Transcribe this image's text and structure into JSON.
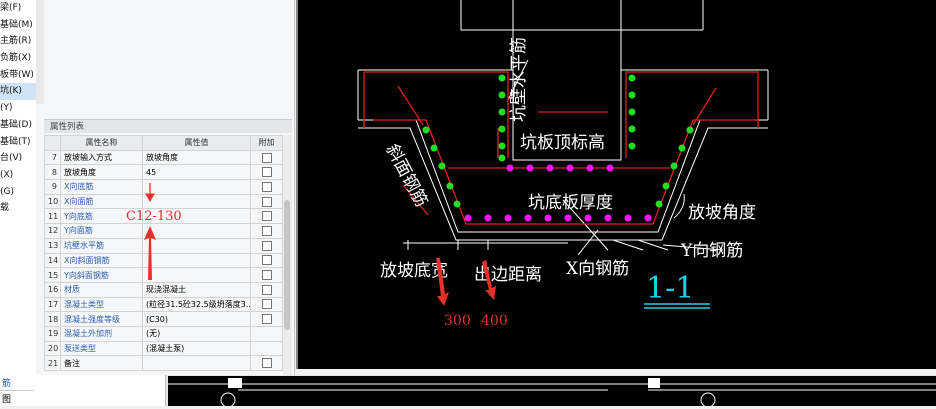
{
  "tree": {
    "items": [
      "梁(F)",
      "基础(M)",
      "主筋(R)",
      "负筋(X)",
      "板带(W)",
      "坑(K)",
      "(Y)",
      "基础(D)",
      "基础(T)",
      "台(V)",
      "(X)",
      "(G)",
      "载"
    ],
    "selected_index": 5
  },
  "props": {
    "title": "属性列表",
    "headers": [
      "属性名称",
      "属性值",
      "附加"
    ],
    "rows": [
      {
        "num": "7",
        "name": "放坡输入方式",
        "value": "放坡角度",
        "blue": false,
        "check": true
      },
      {
        "num": "8",
        "name": "放坡角度",
        "value": "45",
        "blue": false,
        "check": true
      },
      {
        "num": "9",
        "name": "X向底筋",
        "value": "",
        "blue": true,
        "check": true
      },
      {
        "num": "10",
        "name": "X向面筋",
        "value": "",
        "blue": true,
        "check": true
      },
      {
        "num": "11",
        "name": "Y向底筋",
        "value": "",
        "blue": true,
        "check": true
      },
      {
        "num": "12",
        "name": "Y向面筋",
        "value": "",
        "blue": true,
        "check": true
      },
      {
        "num": "13",
        "name": "坑壁水平筋",
        "value": "",
        "blue": true,
        "check": true
      },
      {
        "num": "14",
        "name": "X向斜面钢筋",
        "value": "",
        "blue": true,
        "check": true
      },
      {
        "num": "15",
        "name": "Y向斜面钢筋",
        "value": "",
        "blue": true,
        "check": true
      },
      {
        "num": "16",
        "name": "材质",
        "value": "现浇混凝土",
        "blue": true,
        "check": true
      },
      {
        "num": "17",
        "name": "混凝土类型",
        "value": "(粒径31.5砼32.5级坍落度3...",
        "blue": true,
        "check": true
      },
      {
        "num": "18",
        "name": "混凝土强度等级",
        "value": "(C30)",
        "blue": true,
        "check": true
      },
      {
        "num": "19",
        "name": "混凝土外加剂",
        "value": "(无)",
        "blue": true,
        "check": false
      },
      {
        "num": "20",
        "name": "泵送类型",
        "value": "(混凝土泵)",
        "blue": true,
        "check": false
      },
      {
        "num": "21",
        "name": "备注",
        "value": "",
        "blue": false,
        "check": true
      }
    ]
  },
  "annotations": {
    "rebar_note": "C12-130",
    "value_left": "300",
    "value_right": "400",
    "color": "#e8302a"
  },
  "cad": {
    "labels": {
      "wall_horizontal": "坑壁水平筋",
      "top_elevation": "坑板顶标高",
      "bottom_thickness": "坑底板厚度",
      "slope_rebar": "斜面钢筋",
      "slope_angle": "放坡角度",
      "y_rebar": "Y向钢筋",
      "x_rebar": "X向钢筋",
      "slope_width": "放坡底宽",
      "edge_distance": "出边距离",
      "section": "1-1"
    },
    "colors": {
      "background": "#000000",
      "line": "#ffffff",
      "rebar": "#e02020",
      "dots_green": "#22dd22",
      "dots_magenta": "#ff10ff",
      "section": "#19d2e6"
    }
  },
  "bottom": {
    "left_items": [
      "筋",
      "图"
    ]
  }
}
